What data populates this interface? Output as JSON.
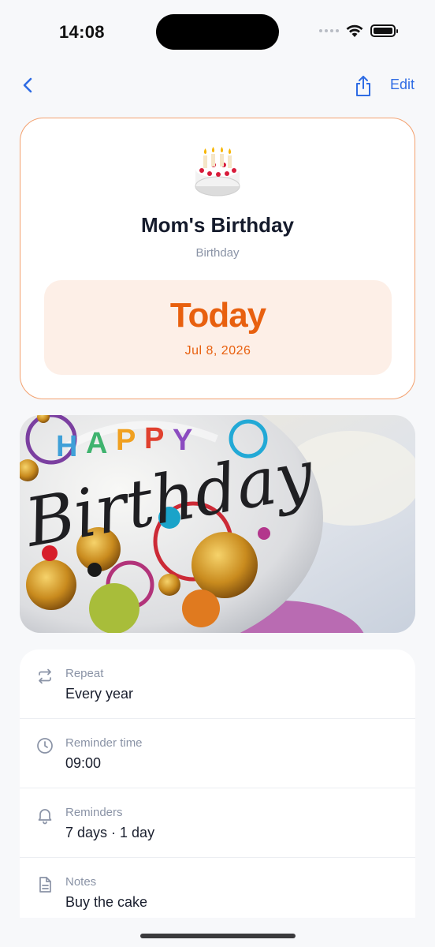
{
  "status_bar": {
    "time": "14:08"
  },
  "nav": {
    "back_icon": "chevron-left-icon",
    "share_icon": "share-icon",
    "edit_label": "Edit"
  },
  "event": {
    "emoji": "🎂",
    "title": "Mom's Birthday",
    "category": "Birthday",
    "countdown": "Today",
    "date": "Jul 8, 2026"
  },
  "photo": {
    "icon": "birthday-balloon-image"
  },
  "details": [
    {
      "icon": "repeat-icon",
      "label": "Repeat",
      "value": "Every year"
    },
    {
      "icon": "clock-icon",
      "label": "Reminder time",
      "value": "09:00"
    },
    {
      "icon": "bell-icon",
      "label": "Reminders",
      "value": "7 days · 1 day"
    },
    {
      "icon": "notes-icon",
      "label": "Notes",
      "value": "Buy the cake"
    }
  ],
  "colors": {
    "accent": "#2f6ce4",
    "highlight": "#e8600f",
    "card_border": "#f3a16f",
    "date_bg": "#fdefe7"
  }
}
